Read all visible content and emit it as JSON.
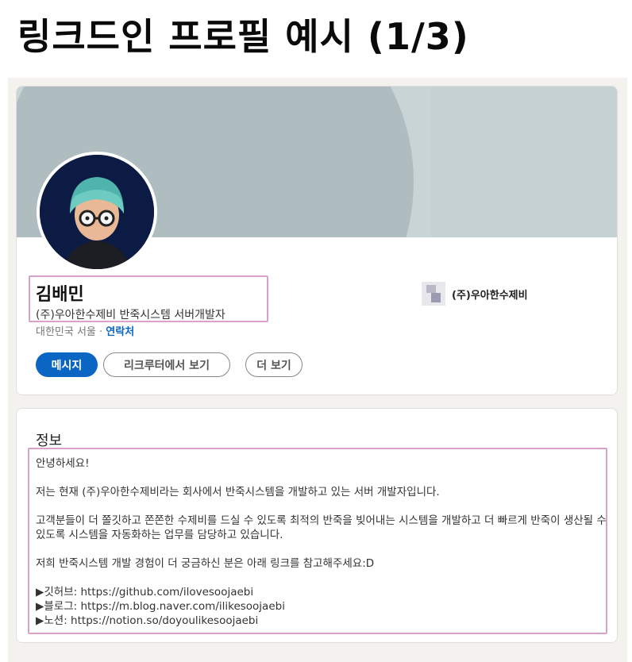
{
  "page_title": "링크드인 프로필 예시 (1/3)",
  "profile": {
    "name": "김배민",
    "headline": "(주)우아한수제비 반죽시스템 서버개발자",
    "location": "대한민국 서울 · ",
    "contact_label": "연락처",
    "company": "(주)우아한수제비",
    "buttons": {
      "message": "메시지",
      "recruiter": "리크루터에서 보기",
      "more": "더 보기"
    },
    "colors": {
      "accent": "#0a66c2",
      "highlight": "#d9a3c9"
    }
  },
  "about": {
    "title": "정보",
    "greeting": "안녕하세요!",
    "intro": "저는 현재 (주)우아한수제비라는 회사에서 반죽시스템을 개발하고 있는 서버 개발자입니다.",
    "description": "고객분들이 더 쫄깃하고 쫀쫀한 수제비를 드실 수 있도록 최적의 반죽을 빚어내는 시스템을 개발하고 더 빠르게 반죽이 생산될 수 있도록 시스템을 자동화하는 업무를 담당하고 있습니다.",
    "cta": "저희 반죽시스템 개발 경험이 더 궁금하신 분은 아래 링크를 참고해주세요:D",
    "links": [
      "▶깃허브: https://github.com/ilovesoojaebi",
      "▶블로그: https://m.blog.naver.com/ilikesoojaebi",
      "▶노션: https://notion.so/doyoulikesoojaebi"
    ]
  }
}
